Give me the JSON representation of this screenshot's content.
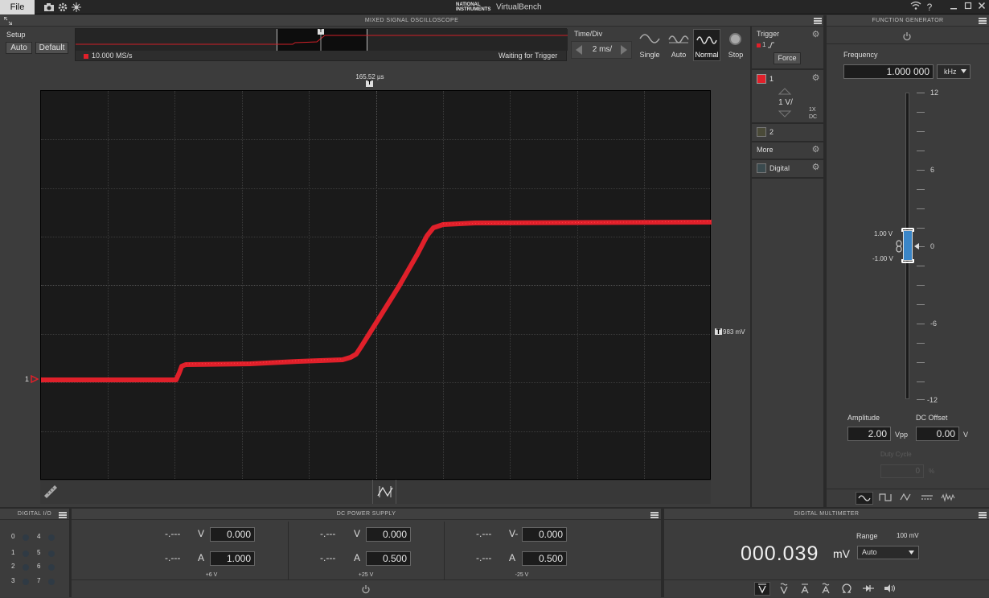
{
  "titlebar": {
    "file_label": "File",
    "brand_logo": "NATIONAL INSTRUMENTS",
    "app_title": "VirtualBench",
    "icons": [
      "camera-icon",
      "settings-icon",
      "wifi-icon",
      "help-icon",
      "minimize-icon",
      "maximize-icon",
      "close-icon"
    ],
    "help": "?"
  },
  "oscilloscope": {
    "header": "MIXED SIGNAL OSCILLOSCOPE",
    "setup_label": "Setup",
    "auto_label": "Auto",
    "default_label": "Default",
    "sample_rate": "10.000 MS/s",
    "status": "Waiting for Trigger",
    "time_div_label": "Time/Div",
    "time_div_value": "2 ms/",
    "modes": [
      "Single",
      "Auto",
      "Normal",
      "Stop"
    ],
    "selected_mode": "Normal",
    "trigger_time": "165.52 µs",
    "trigger_level": "983 mV",
    "trigger": {
      "label": "Trigger",
      "source": "1",
      "force_label": "Force"
    },
    "channel1": {
      "label": "1",
      "scale": "1 V/",
      "probe": "1X",
      "coupling": "DC",
      "color": "#e0202a"
    },
    "channel2": {
      "label": "2"
    },
    "more_label": "More",
    "digital_label": "Digital",
    "channel_marker": "1"
  },
  "function_generator": {
    "header": "FUNCTION GENERATOR",
    "frequency_label": "Frequency",
    "frequency_value": "1.000 000",
    "frequency_unit": "kHz",
    "scale_labels": [
      "12",
      "6",
      "0",
      "-6",
      "-12"
    ],
    "high_level": "1.00 V",
    "low_level": "-1.00 V",
    "amplitude_label": "Amplitude",
    "amplitude_value": "2.00",
    "amplitude_unit": "Vpp",
    "offset_label": "DC Offset",
    "offset_value": "0.00",
    "offset_unit": "V",
    "duty_label": "Duty Cycle",
    "duty_value": "0",
    "duty_unit": "%",
    "waveforms": [
      "sine-wave-icon",
      "square-wave-icon",
      "triangle-wave-icon",
      "dc-icon",
      "noise-icon"
    ]
  },
  "digital_io": {
    "header": "DIGITAL I/O",
    "pins": [
      "0",
      "4",
      "1",
      "5",
      "2",
      "6",
      "3",
      "7"
    ]
  },
  "power_supply": {
    "header": "DC POWER SUPPLY",
    "channels": [
      {
        "v_meas": "-.---",
        "v_unit": "V",
        "v_set": "0.000",
        "a_meas": "-.---",
        "a_unit": "A",
        "a_set": "1.000",
        "name": "+6 V"
      },
      {
        "v_meas": "-.---",
        "v_unit": "V",
        "v_set": "0.000",
        "a_meas": "-.---",
        "a_unit": "A",
        "a_set": "0.500",
        "name": "+25 V"
      },
      {
        "v_meas": "-.---",
        "v_unit": "V-",
        "v_set": "0.000",
        "a_meas": "-.---",
        "a_unit": "A",
        "a_set": "0.500",
        "name": "-25 V"
      }
    ]
  },
  "multimeter": {
    "header": "DIGITAL MULTIMETER",
    "range_label": "Range",
    "range_value": "100 mV",
    "reading": "000.039",
    "unit": "mV",
    "range_select": "Auto",
    "modes": [
      "dc-voltage-icon",
      "ac-voltage-icon",
      "dc-current-icon",
      "ac-current-icon",
      "resistance-icon",
      "diode-icon",
      "continuity-icon"
    ]
  }
}
